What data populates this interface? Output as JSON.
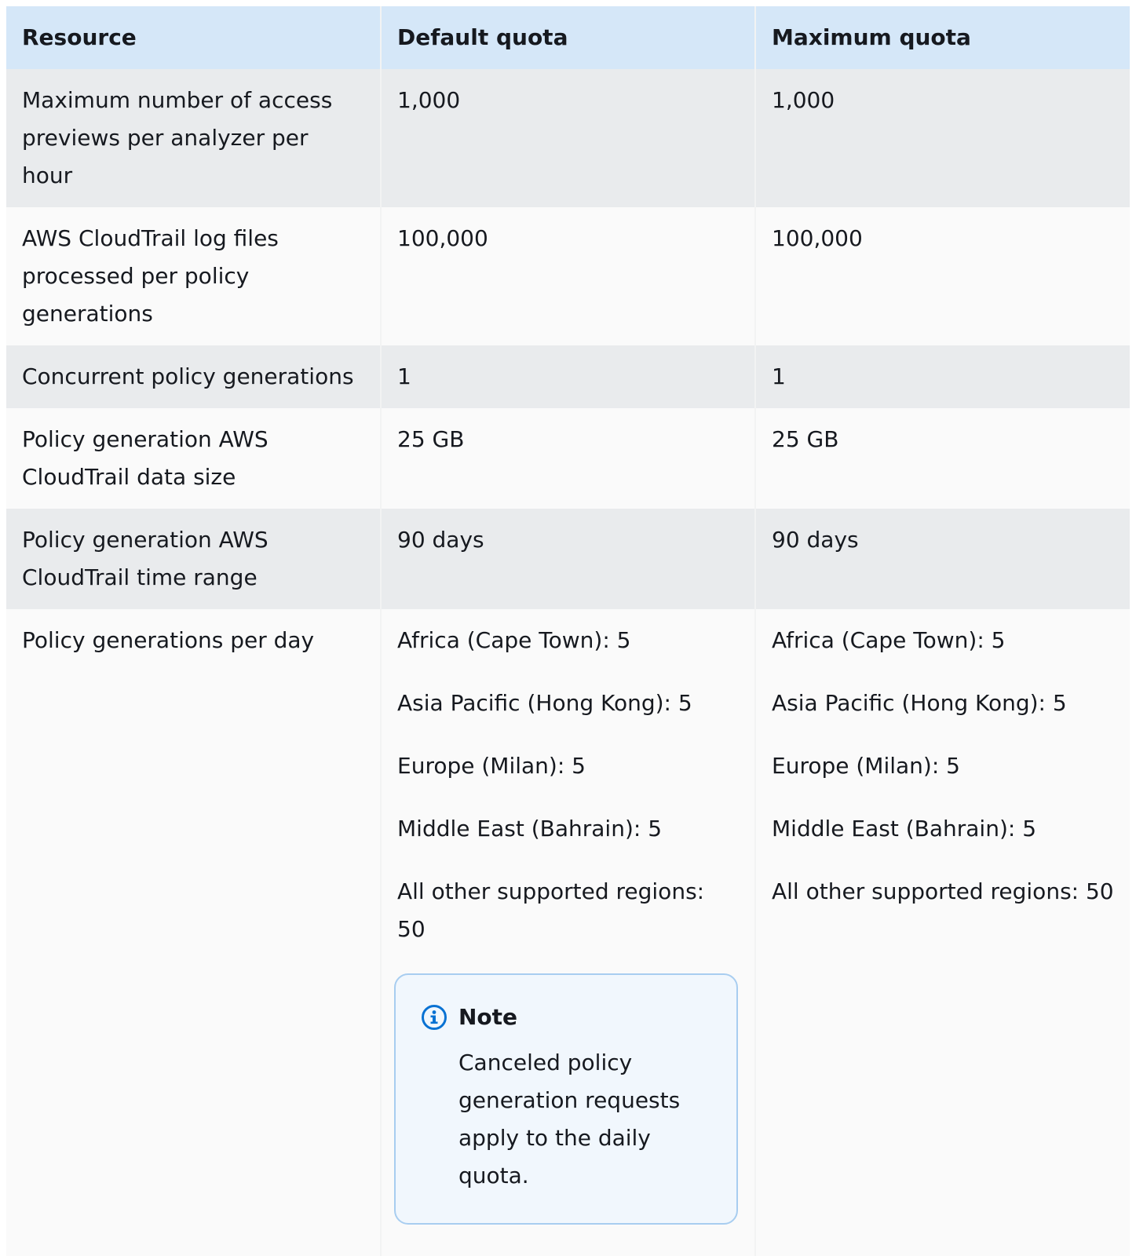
{
  "table": {
    "headers": [
      "Resource",
      "Default quota",
      "Maximum quota"
    ],
    "rows": [
      {
        "resource": "Maximum number of access previews per analyzer per hour",
        "default": "1,000",
        "maximum": "1,000"
      },
      {
        "resource": "AWS CloudTrail log files processed per policy generations",
        "default": "100,000",
        "maximum": "100,000"
      },
      {
        "resource": "Concurrent policy generations",
        "default": "1",
        "maximum": "1"
      },
      {
        "resource": "Policy generation AWS CloudTrail data size",
        "default": "25 GB",
        "maximum": "25 GB"
      },
      {
        "resource": "Policy generation AWS CloudTrail time range",
        "default": "90 days",
        "maximum": "90 days"
      },
      {
        "resource": "Policy generations per day",
        "default": [
          "Africa (Cape Town): 5",
          "Asia Pacific (Hong Kong): 5",
          "Europe (Milan): 5",
          "Middle East (Bahrain): 5",
          "All other supported regions: 50"
        ],
        "maximum": [
          "Africa (Cape Town): 5",
          "Asia Pacific (Hong Kong): 5",
          "Europe (Milan): 5",
          "Middle East (Bahrain): 5",
          "All other supported regions: 50"
        ]
      }
    ]
  },
  "note": {
    "icon": "info-icon",
    "title": "Note",
    "text": "Canceled policy generation requests apply to the daily quota."
  },
  "colors": {
    "header_bg": "#d5e7f8",
    "odd_row_bg": "#e9ebed",
    "even_row_bg": "#fafafa",
    "note_border": "#a8cdf0",
    "note_bg": "#f1f7fd",
    "info_icon": "#0972d3"
  }
}
